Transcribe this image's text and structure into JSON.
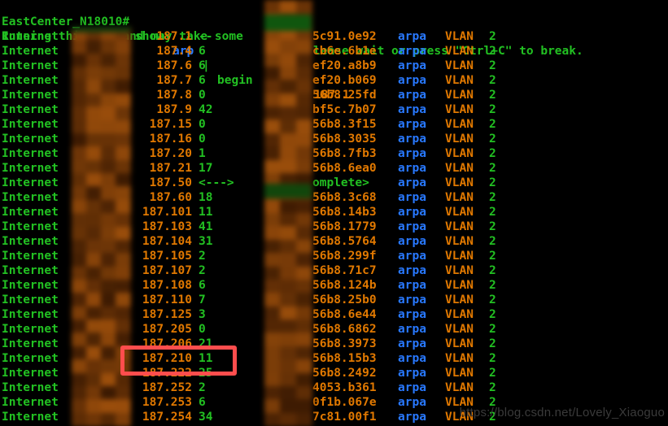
{
  "terminal": {
    "device_prompt": "EastCenter_N18010#",
    "command_head": "show",
    "command_keyword": "arp",
    "pipe": "|",
    "command_filter": "begin",
    "command_arg": "187.1",
    "notice_left": "Running this command may take some",
    "notice_right": "lease wait or press \"Ctrl+C\" to break.",
    "protocol_label": "Internet",
    "type_label": "arpa",
    "interface_label": "VLAN",
    "vlan_id": "2",
    "incomplete_label": "omplete>"
  },
  "colors": {
    "green": "#22c022",
    "orange": "#e07800",
    "blue": "#2878ff",
    "background": "#000000",
    "highlight": "#ff4d4d",
    "watermark": "#3a3a3a",
    "censor": "#8a4a06"
  },
  "arp_table": {
    "rows": [
      {
        "protocol": "Internet",
        "ip": "187.1",
        "age": "--",
        "mac": "5c91.0e92",
        "type": "arpa",
        "interface": "VLAN",
        "vlan": "2"
      },
      {
        "protocol": "Internet",
        "ip": "187.4",
        "age": "6",
        "mac": "cb6e.6b1e",
        "type": "arpa",
        "interface": "VLAN",
        "vlan": "2"
      },
      {
        "protocol": "Internet",
        "ip": "187.6",
        "age": "6",
        "mac": "ef20.a8b9",
        "type": "arpa",
        "interface": "VLAN",
        "vlan": "2"
      },
      {
        "protocol": "Internet",
        "ip": "187.7",
        "age": "6",
        "mac": "ef20.b069",
        "type": "arpa",
        "interface": "VLAN",
        "vlan": "2"
      },
      {
        "protocol": "Internet",
        "ip": "187.8",
        "age": "0",
        "mac": "56b8.25fd",
        "type": "arpa",
        "interface": "VLAN",
        "vlan": "2"
      },
      {
        "protocol": "Internet",
        "ip": "187.9",
        "age": "42",
        "mac": "bf5c.7b07",
        "type": "arpa",
        "interface": "VLAN",
        "vlan": "2"
      },
      {
        "protocol": "Internet",
        "ip": "187.15",
        "age": "0",
        "mac": "56b8.3f15",
        "type": "arpa",
        "interface": "VLAN",
        "vlan": "2"
      },
      {
        "protocol": "Internet",
        "ip": "187.16",
        "age": "0",
        "mac": "56b8.3035",
        "type": "arpa",
        "interface": "VLAN",
        "vlan": "2"
      },
      {
        "protocol": "Internet",
        "ip": "187.20",
        "age": "1",
        "mac": "56b8.7fb3",
        "type": "arpa",
        "interface": "VLAN",
        "vlan": "2"
      },
      {
        "protocol": "Internet",
        "ip": "187.21",
        "age": "17",
        "mac": "56b8.6ea0",
        "type": "arpa",
        "interface": "VLAN",
        "vlan": "2"
      },
      {
        "protocol": "Internet",
        "ip": "187.50",
        "age": "<--->",
        "mac": "omplete>",
        "type": "arpa",
        "interface": "VLAN",
        "vlan": "2"
      },
      {
        "protocol": "Internet",
        "ip": "187.60",
        "age": "18",
        "mac": "56b8.3c68",
        "type": "arpa",
        "interface": "VLAN",
        "vlan": "2"
      },
      {
        "protocol": "Internet",
        "ip": "187.101",
        "age": "11",
        "mac": "56b8.14b3",
        "type": "arpa",
        "interface": "VLAN",
        "vlan": "2"
      },
      {
        "protocol": "Internet",
        "ip": "187.103",
        "age": "41",
        "mac": "56b8.1779",
        "type": "arpa",
        "interface": "VLAN",
        "vlan": "2"
      },
      {
        "protocol": "Internet",
        "ip": "187.104",
        "age": "31",
        "mac": "56b8.5764",
        "type": "arpa",
        "interface": "VLAN",
        "vlan": "2"
      },
      {
        "protocol": "Internet",
        "ip": "187.105",
        "age": "2",
        "mac": "56b8.299f",
        "type": "arpa",
        "interface": "VLAN",
        "vlan": "2"
      },
      {
        "protocol": "Internet",
        "ip": "187.107",
        "age": "2",
        "mac": "56b8.71c7",
        "type": "arpa",
        "interface": "VLAN",
        "vlan": "2"
      },
      {
        "protocol": "Internet",
        "ip": "187.108",
        "age": "6",
        "mac": "56b8.124b",
        "type": "arpa",
        "interface": "VLAN",
        "vlan": "2"
      },
      {
        "protocol": "Internet",
        "ip": "187.110",
        "age": "7",
        "mac": "56b8.25b0",
        "type": "arpa",
        "interface": "VLAN",
        "vlan": "2"
      },
      {
        "protocol": "Internet",
        "ip": "187.125",
        "age": "3",
        "mac": "56b8.6e44",
        "type": "arpa",
        "interface": "VLAN",
        "vlan": "2"
      },
      {
        "protocol": "Internet",
        "ip": "187.205",
        "age": "0",
        "mac": "56b8.6862",
        "type": "arpa",
        "interface": "VLAN",
        "vlan": "2"
      },
      {
        "protocol": "Internet",
        "ip": "187.206",
        "age": "21",
        "mac": "56b8.3973",
        "type": "arpa",
        "interface": "VLAN",
        "vlan": "2"
      },
      {
        "protocol": "Internet",
        "ip": "187.210",
        "age": "11",
        "mac": "56b8.15b3",
        "type": "arpa",
        "interface": "VLAN",
        "vlan": "2"
      },
      {
        "protocol": "Internet",
        "ip": "187.222",
        "age": "25",
        "mac": "56b8.2492",
        "type": "arpa",
        "interface": "VLAN",
        "vlan": "2"
      },
      {
        "protocol": "Internet",
        "ip": "187.252",
        "age": "2",
        "mac": "4053.b361",
        "type": "arpa",
        "interface": "VLAN",
        "vlan": "2"
      },
      {
        "protocol": "Internet",
        "ip": "187.253",
        "age": "6",
        "mac": "0f1b.067e",
        "type": "arpa",
        "interface": "VLAN",
        "vlan": "2"
      },
      {
        "protocol": "Internet",
        "ip": "187.254",
        "age": "34",
        "mac": "7c81.00f1",
        "type": "arpa",
        "interface": "VLAN",
        "vlan": "2"
      }
    ],
    "highlighted_row_index": 22
  },
  "watermark": {
    "text": "https://blog.csdn.net/Lovely_Xiaoguo"
  }
}
